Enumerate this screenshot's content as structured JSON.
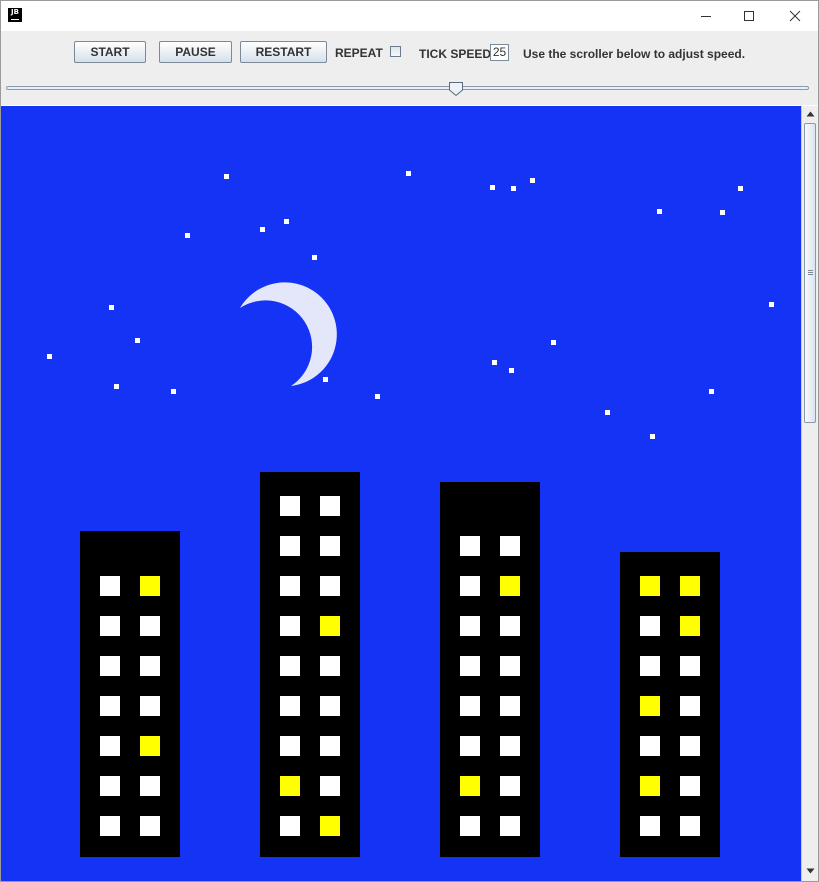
{
  "window": {
    "app_icon_text": "JB",
    "controls": [
      "minimize",
      "maximize",
      "close"
    ]
  },
  "toolbar": {
    "start_label": "START",
    "pause_label": "PAUSE",
    "restart_label": "RESTART",
    "repeat_label": "REPEAT",
    "repeat_checked": false,
    "tick_speed_label": "TICK SPEED",
    "tick_speed_value": "25",
    "hint": "Use the scroller below to adjust speed."
  },
  "speed_slider": {
    "position_fraction": 0.56
  },
  "scene": {
    "sky_color": "#1533f5",
    "building_color": "#000000",
    "window_on_color": "#ffffff",
    "window_lit_color": "#ffff00",
    "moon_color": "#e4e6fa",
    "star_color": "#ffffff",
    "buildings": [
      {
        "name": "building-1",
        "lit_windows": [
          [
            0,
            1
          ],
          [
            4,
            1
          ]
        ]
      },
      {
        "name": "building-2",
        "lit_windows": [
          [
            3,
            1
          ],
          [
            7,
            0
          ],
          [
            8,
            1
          ]
        ]
      },
      {
        "name": "building-3",
        "lit_windows": [
          [
            1,
            1
          ],
          [
            6,
            0
          ]
        ]
      },
      {
        "name": "building-4",
        "lit_windows": [
          [
            0,
            0
          ],
          [
            0,
            1
          ],
          [
            1,
            1
          ],
          [
            3,
            0
          ],
          [
            5,
            0
          ]
        ]
      }
    ]
  },
  "scrollbar": {
    "position_fraction": 0.0
  }
}
